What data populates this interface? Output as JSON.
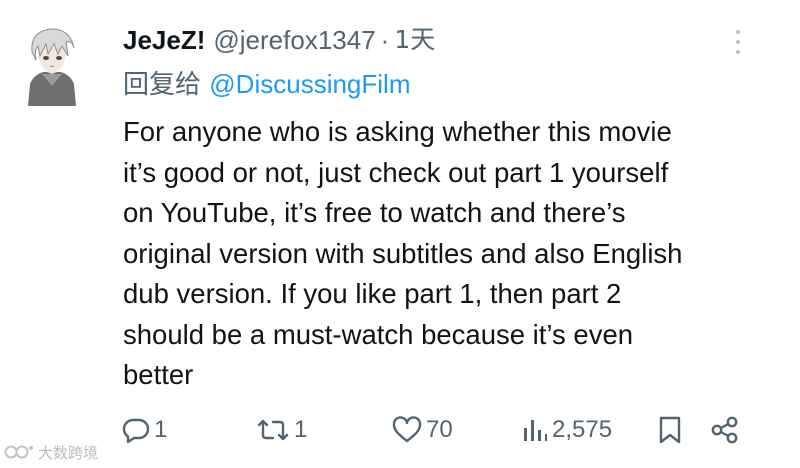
{
  "tweet": {
    "author": {
      "display_name": "JeJeZ!",
      "handle": "@jerefox1347",
      "separator": "·",
      "time": "1天",
      "avatar": "avatar-anime-character"
    },
    "reply_to": {
      "prefix": "回复给",
      "mention": "@DiscussingFilm"
    },
    "body_lines": [
      "For anyone who is asking whether this movie",
      "it’s good or not, just check out part 1 yourself",
      "on YouTube, it’s free to watch and there’s",
      "original version with subtitles and also English",
      "dub version. If you like part 1, then part 2",
      "should be a must-watch because it’s even",
      "better"
    ],
    "actions": {
      "reply": {
        "icon": "reply-icon",
        "count": "1"
      },
      "retweet": {
        "icon": "retweet-icon",
        "count": "1"
      },
      "like": {
        "icon": "heart-icon",
        "count": "70"
      },
      "views": {
        "icon": "views-icon",
        "count": "2,575"
      },
      "bookmark": {
        "icon": "bookmark-icon"
      },
      "share": {
        "icon": "share-icon"
      }
    },
    "more_icon": "more-options-icon"
  },
  "watermark": {
    "text": "大数跨境",
    "icon": "watermark-logo"
  },
  "colors": {
    "text": "#0f1419",
    "secondary": "#536471",
    "link": "#1d9bf0",
    "background": "#ffffff"
  }
}
